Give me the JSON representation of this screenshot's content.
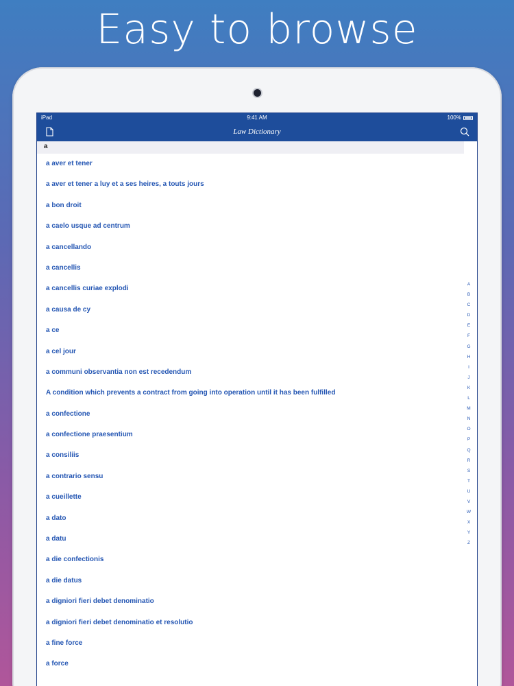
{
  "headline": "Easy to browse",
  "status": {
    "carrier": "iPad",
    "time": "9:41 AM",
    "battery": "100%"
  },
  "navbar": {
    "title": "Law Dictionary",
    "left_icon": "document-icon",
    "right_icon": "search-icon"
  },
  "search": {
    "value": "a"
  },
  "entries": [
    "a aver et tener",
    "a aver et tener a luy et a ses heires, a touts jours",
    "a bon droit",
    "a caelo usque ad centrum",
    "a cancellando",
    "a cancellis",
    "a cancellis curiae explodi",
    "a causa de cy",
    "a ce",
    "a cel jour",
    "a communi observantia non est recedendum",
    "A condition which prevents a contract from going into operation until it has been fulfilled",
    "a confectione",
    "a confectione praesentium",
    "a consiliis",
    "a contrario sensu",
    "a cueillette",
    "a dato",
    "a datu",
    "a die confectionis",
    "a die datus",
    "a digniori fieri debet denominatio",
    "a digniori fieri debet denominatio et resolutio",
    "a fine force",
    "a force"
  ],
  "index_letters": [
    "A",
    "B",
    "C",
    "D",
    "E",
    "F",
    "G",
    "H",
    "I",
    "J",
    "K",
    "L",
    "M",
    "N",
    "O",
    "P",
    "Q",
    "R",
    "S",
    "T",
    "U",
    "V",
    "W",
    "X",
    "Y",
    "Z"
  ],
  "colors": {
    "bar": "#1e4d9b",
    "link": "#2456b3"
  }
}
